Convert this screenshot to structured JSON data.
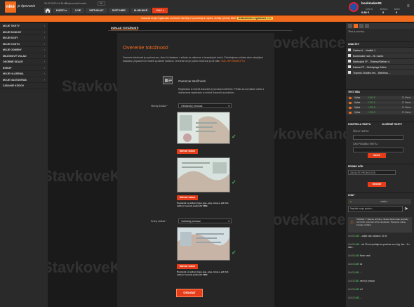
{
  "header": {
    "logo_text": "niké",
    "logo_sub": "je tipovanie",
    "datetime": "26.03.2020   14:45:40",
    "responsible": "Zodpovedné hranie",
    "lang": "SK",
    "nav": [
      {
        "label": "KURZY ▾"
      },
      {
        "label": "LIVE"
      },
      {
        "label": "VIRTUÁLKY"
      },
      {
        "label": "SVET HIER"
      },
      {
        "label": "KLUB NIKÉ"
      },
      {
        "label": "VIAC ▾"
      }
    ],
    "username": "bookmaker81",
    "stats": [
      {
        "label": "KONTO",
        "value": "0.80 €"
      },
      {
        "label": "BONUS",
        "value": "0"
      },
      {
        "label": "BODY",
        "value": "0"
      }
    ]
  },
  "banner": {
    "text": "Dokonči svoju registráciu overením identity a vychutnaj si naplno všetky výhody Niké!",
    "cta": "Dokončenie registrácie >>>"
  },
  "left_sidebar": {
    "items": [
      {
        "label": "MOJE TIKETY",
        "chev": "›"
      },
      {
        "label": "MOJE BONUSY",
        "chev": "›"
      },
      {
        "label": "MOJE BODY",
        "chev": "›"
      },
      {
        "label": "MOJE KONTO",
        "chev": "›"
      },
      {
        "label": "MOJE ODMENY",
        "chev": "›"
      },
      {
        "label": "MILIÓNOVÝ VKLAD",
        "chev": "›"
      },
      {
        "label": "OSOBNÉ ÚDAJE",
        "chev": "›"
      },
      {
        "label": "ESHOP",
        "chev": "›"
      },
      {
        "label": "MOJE HLÁSENIA",
        "chev": "›"
      },
      {
        "label": "MOJE NASTAVENIA",
        "chev": "›"
      },
      {
        "label": "ZADANIE KÓDOV",
        "chev": ""
      }
    ]
  },
  "main": {
    "tab": "DOKLAD TOTOŽNOSTI",
    "title": "Overenie totožnosti",
    "desc": "Overenie totožnosti je povinná vec, ktorú ťa žiadame v súlade so zákonom o hazardných hrách. Potrebujeme od teba sken obvyklých dokladov, prípadne ich môžeš aj odfotiť mobilom. Overenie ich je potom môžeš aj ty na Nike.",
    "more": "VIAC INFORMÁCIÍ TU",
    "over_title": "Overenie totožnosti",
    "over_text": "Registráciu si môžeš dokončiť aj na našom telefóne. Prihlás sa na našom webe a dokončenie registrácie si môžeš dokončiť aj mobilom.",
    "doc1_label": "Hlavný doklad *",
    "doc1_value": "Občiansky preukaz",
    "doc2_label": "Druhý doklad *",
    "doc2_value": "Vodičský preukaz",
    "upload_btn": "Nahrať súbor",
    "note": "Povolené sú súbory typu .jpg, .png, .bmp a .pdf. Ich veľkosť nesmie prekročiť 3MB.",
    "submit": "Odoslať"
  },
  "right_sidebar": {
    "toolbar_label": "Tiket je prázdny.",
    "analyze_title": "ANALÝZY",
    "analyses": [
      {
        "text": "Gavlan A. - Vraštík J."
      },
      {
        "text": "Bookmaker radí - 26. marec"
      },
      {
        "text": "Markotyds FF - Östersy/Fjellner d"
      },
      {
        "text": "Kalmar FF - Jönköpings Södra"
      },
      {
        "text": "Torpedo Zhodino res. - Belshina ..."
      }
    ],
    "tips_title": "TEXT DŇA",
    "tips": [
      {
        "label": "Výhra",
        "amount": "4 050 €",
        "date": "21 Marec"
      },
      {
        "label": "Výhra",
        "amount": "2 500 €",
        "date": "21 Marec"
      },
      {
        "label": "Výhra",
        "amount": "1 606 €",
        "date": "21 Marec"
      },
      {
        "label": "Výhra",
        "amount": "1 006 €",
        "date": "21 Marec"
      }
    ],
    "control_title": "KONTROLA TIKETU",
    "control_tab2": "ULOŽENÉ TIKETY",
    "ticket_no_label": "ČÍSLO TIKETU",
    "ticket_time_label": "ČAS PODANIA TIKETU",
    "control_btn": "Overiť",
    "promo_title": "PROMO KÓD",
    "promo_placeholder": "ZADAJTE PROMO KÓD",
    "promo_btn": "Odoslať",
    "chat_title": "CHAT",
    "chat_input_placeholder": "Napíšte svoju správu...",
    "chat_user_label": "všetko",
    "chat_notice": "OZNAM: V záujme ochrany zdravia budú naše pobočky od 13.03. uzavreté až do odvolania. Tipovanie online funguje naďalej.",
    "chat_msgs": [
      {
        "user": "1448",
        "time": "14:45",
        "text": "...zajtra viac zápasov 14:40"
      },
      {
        "user": "1448",
        "time": "14:45",
        "text": "...da 30 min pridajte sa pozrime sa o tipy Jan... 6 x stav..."
      },
      {
        "user": "1449",
        "time": "14:45",
        "text": "Nech vesti"
      },
      {
        "user": "1450",
        "time": "14:44",
        "text": "ok"
      },
      {
        "user": "1451",
        "time": "14:43",
        "text": "..."
      },
      {
        "user": "1451",
        "time": "14:43",
        "text": "nech je pravda"
      },
      {
        "user": "1452",
        "time": "14:43",
        "text": "to?"
      },
      {
        "user": "1453",
        "time": "14:42",
        "text": "..."
      }
    ]
  },
  "watermark": "StavkoveKancelarie.com",
  "colors": {
    "accent": "#f26b1d",
    "cta": "#e53c19",
    "ok": "#4caf50"
  }
}
